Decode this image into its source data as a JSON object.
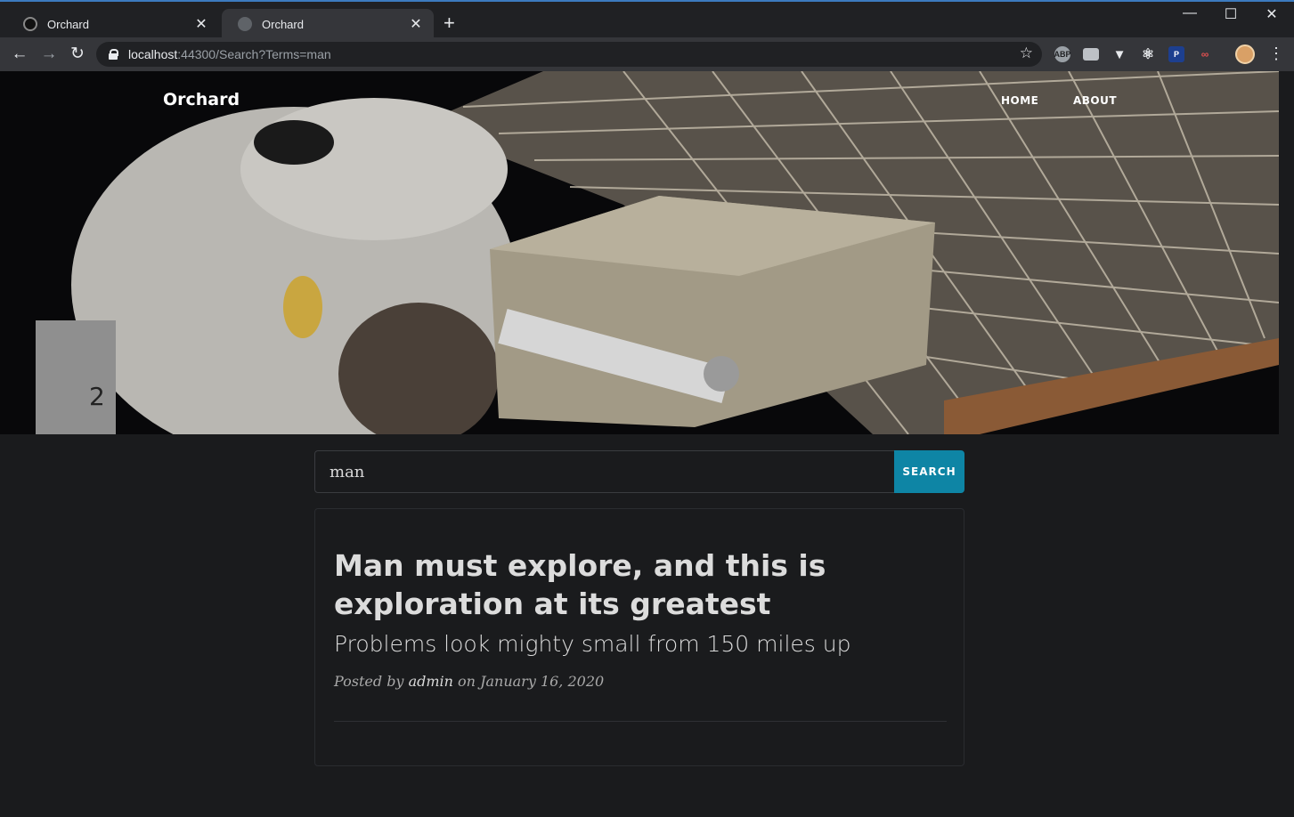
{
  "browser": {
    "tabs": [
      {
        "title": "Orchard",
        "active": false
      },
      {
        "title": "Orchard",
        "active": true
      }
    ],
    "url_host": "localhost",
    "url_rest": ":44300/Search?Terms=man",
    "window_controls": {
      "minimize": "—",
      "maximize": "☐",
      "close": "✕"
    },
    "extensions": [
      "abp-icon",
      "camera-icon",
      "vue-icon",
      "react-icon",
      "key-icon",
      "glasses-icon"
    ]
  },
  "site": {
    "brand": "Orchard",
    "nav": {
      "home": "HOME",
      "about": "ABOUT"
    }
  },
  "search": {
    "value": "man",
    "button_label": "SEARCH"
  },
  "results": [
    {
      "title": "Man must explore, and this is exploration at its greatest",
      "subtitle": "Problems look mighty small from 150 miles up",
      "meta_prefix": "Posted by",
      "author": "admin",
      "meta_on": "on",
      "date": "January 16, 2020"
    }
  ],
  "colors": {
    "accent": "#0e85a5",
    "page_bg": "#1a1b1d",
    "chrome_tabbar": "#202124",
    "chrome_toolbar": "#35363a"
  }
}
